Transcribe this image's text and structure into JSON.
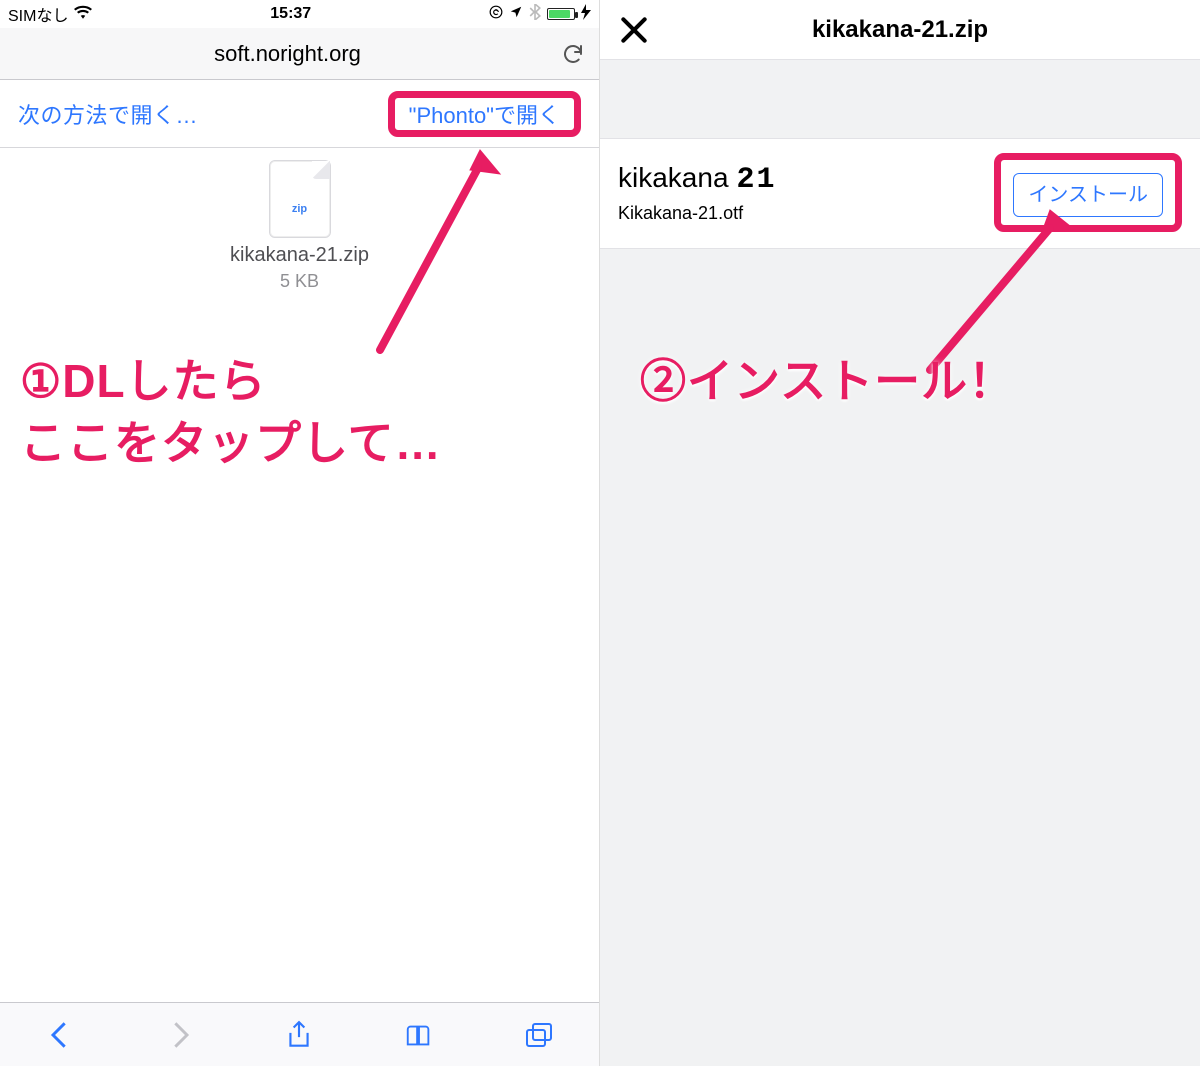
{
  "left": {
    "status": {
      "carrier": "SIMなし",
      "time": "15:37",
      "wifi_icon": "wifi",
      "lock_icon": "rotation-lock",
      "location_icon": "location",
      "bluetooth_icon": "bluetooth",
      "charging_icon": "bolt"
    },
    "nav": {
      "url": "soft.noright.org",
      "reload_icon": "reload"
    },
    "actions": {
      "open_with": "次の方法で開く…",
      "open_phonto": "\"Phonto\"で開く"
    },
    "file": {
      "ext": "zip",
      "name": "kikakana-21.zip",
      "size": "5 KB"
    },
    "annotation": "①DLしたら\nここをタップして…",
    "toolbar": {
      "back": "back",
      "forward": "forward",
      "share": "share",
      "bookmarks": "bookmarks",
      "tabs": "tabs"
    }
  },
  "right": {
    "header": {
      "title": "kikakana-21.zip",
      "close_icon": "close"
    },
    "font": {
      "display_name": "kikakana",
      "display_num": "21",
      "filename": "Kikakana-21.otf",
      "install_label": "インストール"
    },
    "annotation": "②インストール！"
  },
  "colors": {
    "accent_pink": "#e71d62",
    "ios_blue": "#2e77ff",
    "battery_green": "#4cd964"
  }
}
